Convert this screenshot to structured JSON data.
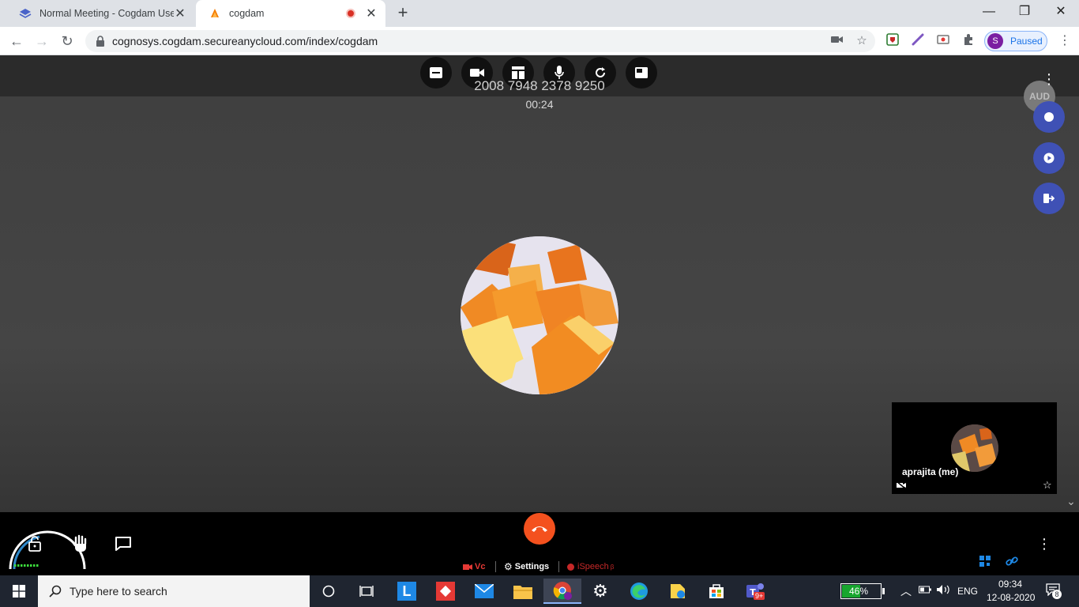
{
  "browser": {
    "tabs": [
      {
        "title": "Normal Meeting - Cogdam User",
        "active": false
      },
      {
        "title": "cogdam",
        "active": true
      }
    ],
    "url": "cognosys.cogdam.secureanycloud.com/index/cogdam",
    "profile_initial": "S",
    "profile_status": "Paused"
  },
  "meeting": {
    "id": "2008 7948 2378 9250",
    "timer": "00:24",
    "aud_badge": "AUD",
    "self_name": "aprajita (me)",
    "bottom_menu": {
      "vc": "Vc",
      "settings": "Settings",
      "ispeech": "iSpeech",
      "ispeech_sup": "β"
    },
    "colors": {
      "accent": "#3f51b5",
      "hangup": "#f4511e",
      "recording": "#d93025"
    }
  },
  "taskbar": {
    "search_placeholder": "Type here to search",
    "battery": "46%",
    "language": "ENG",
    "time": "09:34",
    "date": "12-08-2020",
    "notifications": "8",
    "teams_badge": "9+"
  }
}
